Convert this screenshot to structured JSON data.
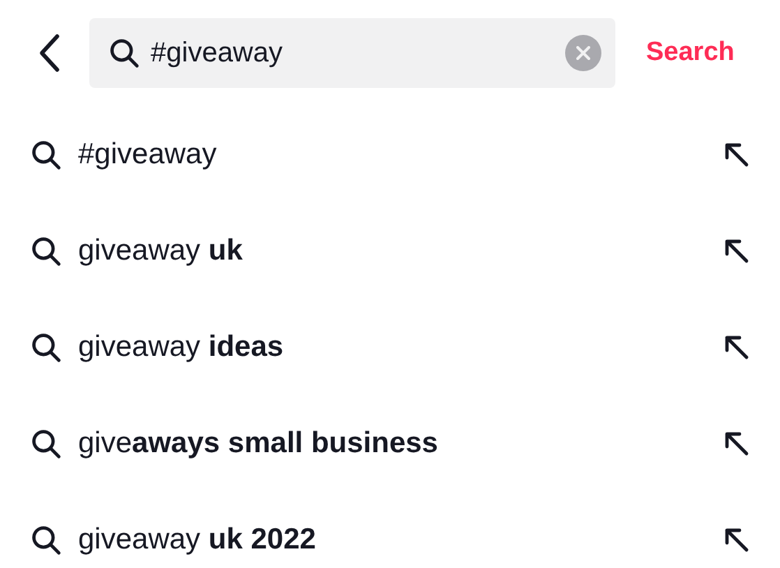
{
  "search_bar": {
    "value": "#giveaway",
    "action": "Search"
  },
  "suggestions": [
    {
      "text": "#giveaway"
    },
    {
      "text": "giveaway **uk**"
    },
    {
      "text": "giveaway **ideas**"
    },
    {
      "text": "give**aways small business**"
    },
    {
      "text": "giveaway **uk 2022**"
    }
  ]
}
